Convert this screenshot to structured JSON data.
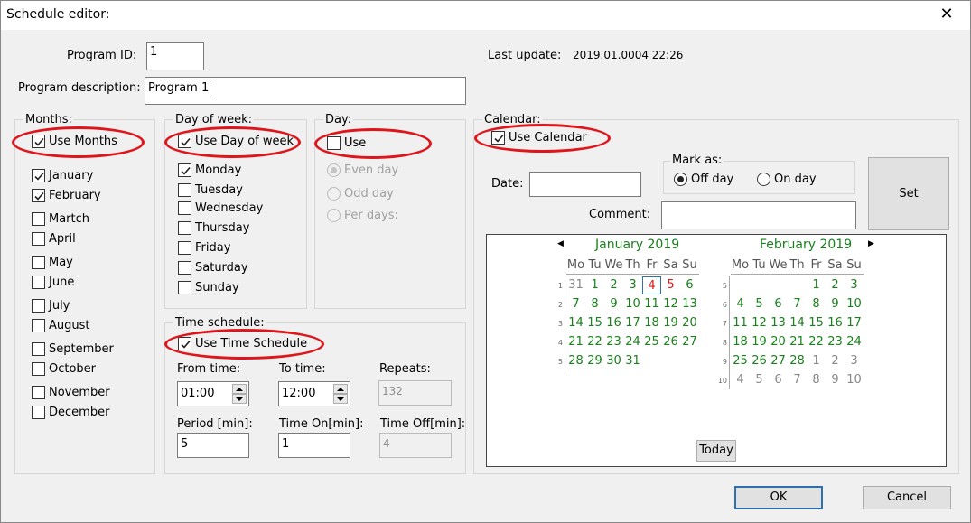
{
  "window": {
    "title": "Schedule editor:",
    "close_glyph": "✕"
  },
  "program": {
    "id_label": "Program ID:",
    "id_value": "1",
    "desc_label": "Program description:",
    "desc_value": "Program 1",
    "last_update_label": "Last update:",
    "last_update_value": "2019.01.0004 22:26"
  },
  "months": {
    "group_label": "Months:",
    "use_label": "Use Months",
    "use_checked": true,
    "items": [
      {
        "label": "January",
        "checked": true
      },
      {
        "label": "February",
        "checked": true
      },
      {
        "label": "Martch",
        "checked": false
      },
      {
        "label": "April",
        "checked": false
      },
      {
        "label": "May",
        "checked": false
      },
      {
        "label": "June",
        "checked": false
      },
      {
        "label": "July",
        "checked": false
      },
      {
        "label": "August",
        "checked": false
      },
      {
        "label": "September",
        "checked": false
      },
      {
        "label": "October",
        "checked": false
      },
      {
        "label": "November",
        "checked": false
      },
      {
        "label": "December",
        "checked": false
      }
    ]
  },
  "dow": {
    "group_label": "Day of week:",
    "use_label": "Use Day of week",
    "use_checked": true,
    "items": [
      {
        "label": "Monday",
        "checked": true
      },
      {
        "label": "Tuesday",
        "checked": false
      },
      {
        "label": "Wednesday",
        "checked": false
      },
      {
        "label": "Thursday",
        "checked": false
      },
      {
        "label": "Friday",
        "checked": false
      },
      {
        "label": "Saturday",
        "checked": false
      },
      {
        "label": "Sunday",
        "checked": false
      }
    ]
  },
  "day": {
    "group_label": "Day:",
    "use_label": "Use",
    "use_checked": false,
    "options": [
      {
        "label": "Even day",
        "selected": true
      },
      {
        "label": "Odd day",
        "selected": false
      },
      {
        "label": "Per days:",
        "selected": false
      }
    ]
  },
  "time": {
    "group_label": "Time schedule:",
    "use_label": "Use Time Schedule",
    "use_checked": true,
    "from_label": "From time:",
    "from_value": "01:00",
    "to_label": "To time:",
    "to_value": "12:00",
    "repeats_label": "Repeats:",
    "repeats_value": "132",
    "period_label": "Period [min]:",
    "period_value": "5",
    "on_label": "Time On[min]:",
    "on_value": "1",
    "off_label": "Time Off[min]:",
    "off_value": "4"
  },
  "calendar": {
    "group_label": "Calendar:",
    "use_label": "Use Calendar",
    "use_checked": true,
    "date_label": "Date:",
    "date_value": "",
    "comment_label": "Comment:",
    "comment_value": "",
    "mark_label": "Mark as:",
    "off_label": "Off day",
    "on_label": "On day",
    "off_selected": true,
    "set_label": "Set",
    "today_label": "Today",
    "prev_glyph": "◀",
    "next_glyph": "▶",
    "day_headers": [
      "Mo",
      "Tu",
      "We",
      "Th",
      "Fr",
      "Sa",
      "Su"
    ],
    "months": [
      {
        "title": "January 2019",
        "weeks": [
          "1",
          "2",
          "3",
          "4",
          "5"
        ],
        "rows": [
          [
            "31",
            "1",
            "2",
            "3",
            "4",
            "5",
            "6"
          ],
          [
            "7",
            "8",
            "9",
            "10",
            "11",
            "12",
            "13"
          ],
          [
            "14",
            "15",
            "16",
            "17",
            "18",
            "19",
            "20"
          ],
          [
            "21",
            "22",
            "23",
            "24",
            "25",
            "26",
            "27"
          ],
          [
            "28",
            "29",
            "30",
            "31",
            "",
            "",
            ""
          ]
        ],
        "gray": [
          "0-0"
        ],
        "red": [
          "0-4",
          "0-5"
        ],
        "today": "0-4"
      },
      {
        "title": "February 2019",
        "weeks": [
          "5",
          "6",
          "7",
          "8",
          "9",
          "10"
        ],
        "rows": [
          [
            "",
            "",
            "",
            "",
            "1",
            "2",
            "3"
          ],
          [
            "4",
            "5",
            "6",
            "7",
            "8",
            "9",
            "10"
          ],
          [
            "11",
            "12",
            "13",
            "14",
            "15",
            "16",
            "17"
          ],
          [
            "18",
            "19",
            "20",
            "21",
            "22",
            "23",
            "24"
          ],
          [
            "25",
            "26",
            "27",
            "28",
            "1",
            "2",
            "3"
          ],
          [
            "4",
            "5",
            "6",
            "7",
            "8",
            "9",
            "10"
          ]
        ],
        "gray": [
          "4-4",
          "4-5",
          "4-6",
          "5-0",
          "5-1",
          "5-2",
          "5-3",
          "5-4",
          "5-5",
          "5-6"
        ],
        "red": [],
        "today": ""
      }
    ]
  },
  "footer": {
    "ok_label": "OK",
    "cancel_label": "Cancel"
  },
  "colors": {
    "highlight_oval": "#e0151b",
    "calendar_green": "#19801c",
    "calendar_red": "#d91b1b",
    "ok_border": "#2f6fb0"
  }
}
